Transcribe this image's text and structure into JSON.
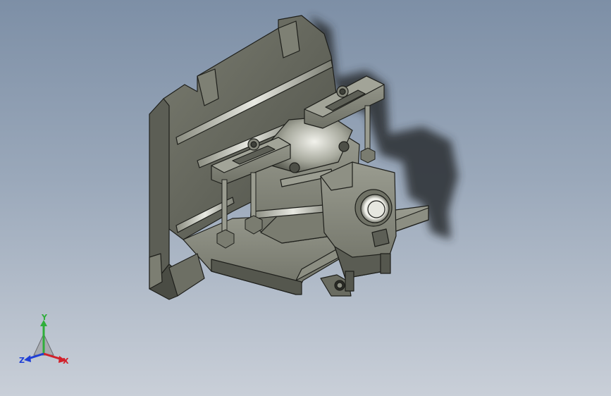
{
  "viewport": {
    "background_top": "#7d8fa6",
    "background_bottom": "#c9cfd8",
    "model_color": "#6e7065",
    "model_edge_color": "#1e1f1b"
  },
  "triad": {
    "x_label": "X",
    "y_label": "Y",
    "z_label": "Z",
    "x_color": "#d2202a",
    "y_color": "#2fae3a",
    "z_color": "#1f3fd6"
  }
}
